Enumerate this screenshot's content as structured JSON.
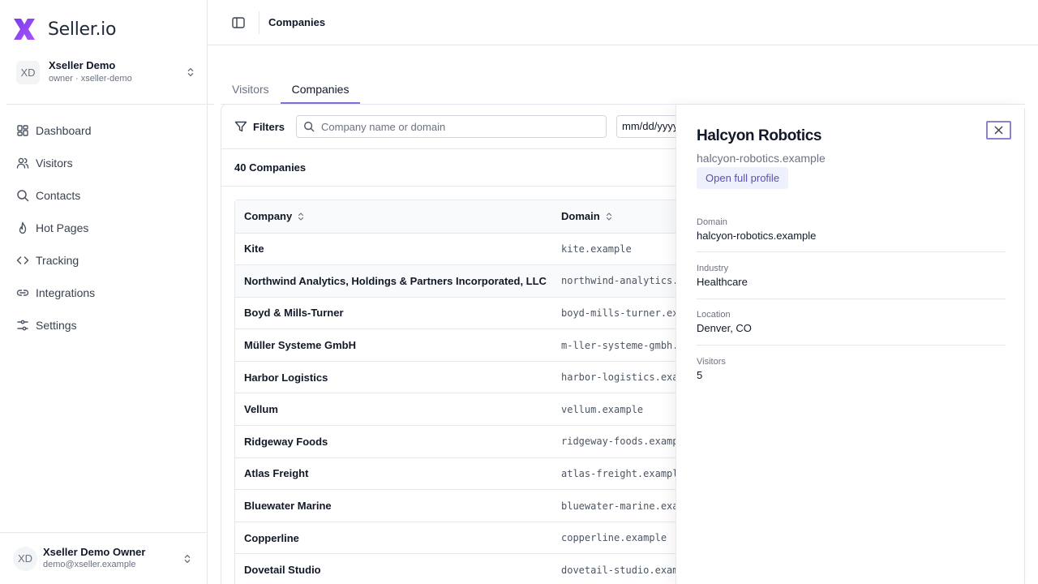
{
  "brand": {
    "name": "Seller.io",
    "accent": "#8b5cf6"
  },
  "workspace": {
    "initials": "XD",
    "name": "Xseller Demo",
    "subtitle": "owner · xseller-demo"
  },
  "nav": [
    {
      "label": "Dashboard",
      "icon": "dashboard-icon"
    },
    {
      "label": "Visitors",
      "icon": "users-icon"
    },
    {
      "label": "Contacts",
      "icon": "search-icon"
    },
    {
      "label": "Hot Pages",
      "icon": "flame-icon"
    },
    {
      "label": "Tracking",
      "icon": "code-icon"
    },
    {
      "label": "Integrations",
      "icon": "link-icon"
    },
    {
      "label": "Settings",
      "icon": "sliders-icon"
    }
  ],
  "user": {
    "initials": "XD",
    "name": "Xseller Demo Owner",
    "email": "demo@xseller.example"
  },
  "header": {
    "title": "Companies"
  },
  "tabs": [
    {
      "label": "Visitors",
      "active": false
    },
    {
      "label": "Companies",
      "active": true
    }
  ],
  "toolbar": {
    "filters_label": "Filters",
    "search_placeholder": "Company name or domain",
    "date_placeholder": "mm/dd/yyyy"
  },
  "count_label": "40 Companies",
  "table": {
    "columns": [
      "Company",
      "Domain"
    ],
    "rows": [
      {
        "company": "Kite",
        "domain": "kite.example"
      },
      {
        "company": "Northwind Analytics, Holdings & Partners Incorporated, LLC",
        "domain": "northwind-analytics.example"
      },
      {
        "company": "Boyd & Mills-Turner",
        "domain": "boyd-mills-turner.example"
      },
      {
        "company": "Müller Systeme GmbH",
        "domain": "m-ller-systeme-gmbh.example"
      },
      {
        "company": "Harbor Logistics",
        "domain": "harbor-logistics.example"
      },
      {
        "company": "Vellum",
        "domain": "vellum.example"
      },
      {
        "company": "Ridgeway Foods",
        "domain": "ridgeway-foods.example"
      },
      {
        "company": "Atlas Freight",
        "domain": "atlas-freight.example"
      },
      {
        "company": "Bluewater Marine",
        "domain": "bluewater-marine.example"
      },
      {
        "company": "Copperline",
        "domain": "copperline.example"
      },
      {
        "company": "Dovetail Studio",
        "domain": "dovetail-studio.example"
      }
    ]
  },
  "detail": {
    "title": "Halcyon Robotics",
    "domain": "halcyon-robotics.example",
    "profile_button": "Open full profile",
    "fields": [
      {
        "label": "Domain",
        "value": "halcyon-robotics.example"
      },
      {
        "label": "Industry",
        "value": "Healthcare"
      },
      {
        "label": "Location",
        "value": "Denver, CO"
      },
      {
        "label": "Visitors",
        "value": "5"
      }
    ]
  }
}
